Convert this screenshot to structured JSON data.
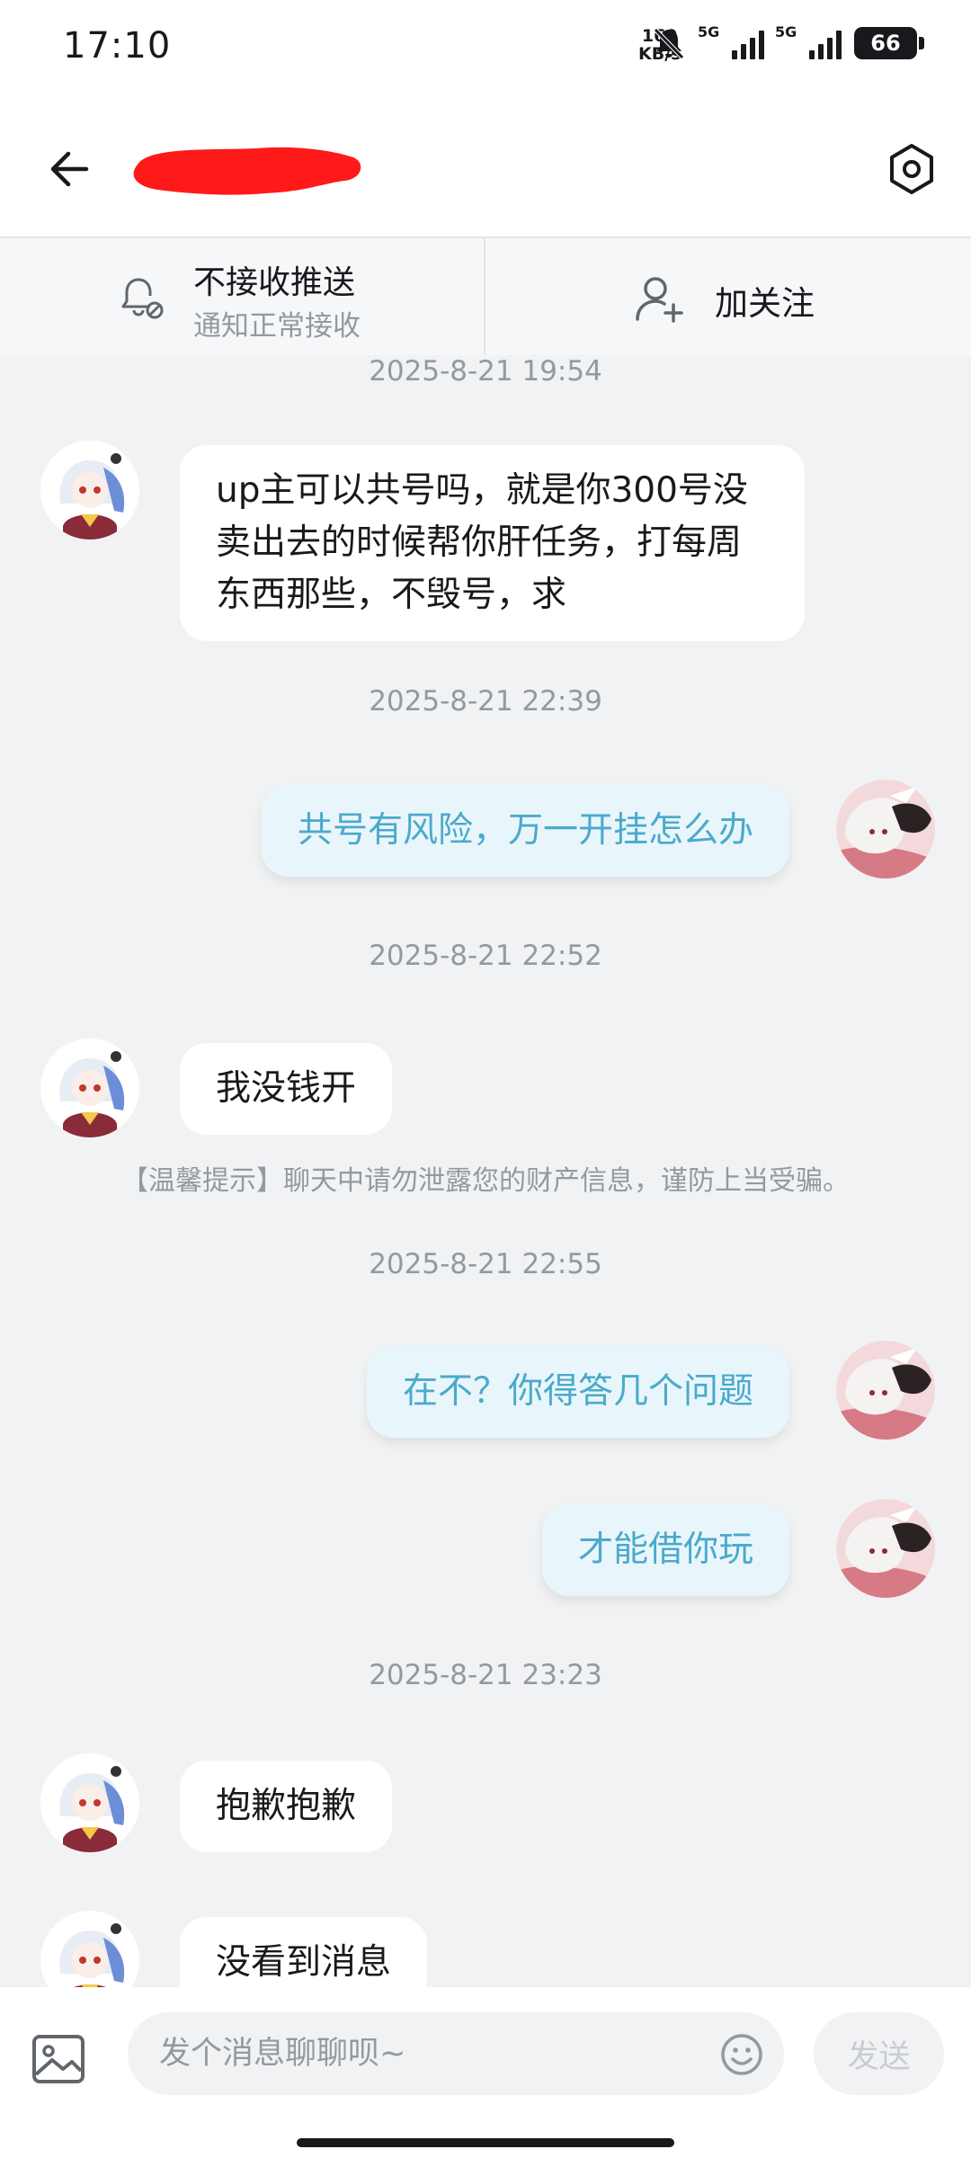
{
  "status_bar": {
    "time": "17:10",
    "net_speed_value": "169",
    "net_speed_unit": "KB/s",
    "signal_1": "5G",
    "signal_2": "5G",
    "battery": "66"
  },
  "header": {
    "back_icon": "arrow-left-icon",
    "settings_icon": "hexagon-settings-icon",
    "title_redacted": true
  },
  "actions": {
    "push_title": "不接收推送",
    "push_sub": "通知正常接收",
    "follow_label": "加关注"
  },
  "messages": [
    {
      "timestamp": "2025-8-21 19:54"
    },
    {
      "side": "in",
      "text": "up主可以共号吗，就是你300号没卖出去的时候帮你肝任务，打每周东西那些，不毁号，求"
    },
    {
      "timestamp": "2025-8-21 22:39"
    },
    {
      "side": "out",
      "text": "共号有风险，万一开挂怎么办"
    },
    {
      "timestamp": "2025-8-21 22:52"
    },
    {
      "side": "in",
      "text": "我没钱开"
    },
    {
      "tip": "【温馨提示】聊天中请勿泄露您的财产信息，谨防上当受骗。"
    },
    {
      "timestamp": "2025-8-21 22:55"
    },
    {
      "side": "out",
      "text": "在不？你得答几个问题"
    },
    {
      "side": "out",
      "text": "才能借你玩"
    },
    {
      "timestamp": "2025-8-21 23:23"
    },
    {
      "side": "in",
      "text": "抱歉抱歉"
    },
    {
      "side": "in",
      "text": "没看到消息"
    }
  ],
  "composer": {
    "placeholder": "发个消息聊聊呗~",
    "send_label": "发送"
  },
  "colors": {
    "background": "#f1f2f3",
    "outgoing_bubble": "#e8f6fb",
    "outgoing_text": "#4ba9cc",
    "muted_text": "#9499a0",
    "redaction": "#ff1a1a"
  }
}
